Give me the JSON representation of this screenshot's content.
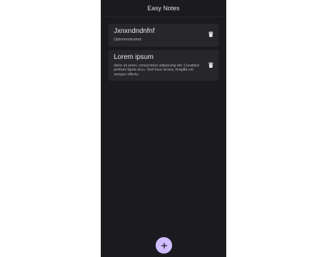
{
  "app_bar": {
    "title": "Easy Notes"
  },
  "notes": [
    {
      "title": "Jxnxndndnfnf",
      "body": "Djdmmmdmdmd"
    },
    {
      "title": "Lorem ipsum",
      "body": "dolor sit amet, consectetur adipiscing elit. Curabitur pretium ligula arcu. Sed risus lectus, fringilla vel semper efficitu"
    }
  ],
  "icons": {
    "delete": "trash-icon",
    "add": "plus-icon"
  },
  "colors": {
    "background": "#1b1b1f",
    "card": "#26262b",
    "fab": "#d0bcff",
    "text_primary": "#e9e6ea",
    "text_secondary": "#b8b4bb"
  }
}
